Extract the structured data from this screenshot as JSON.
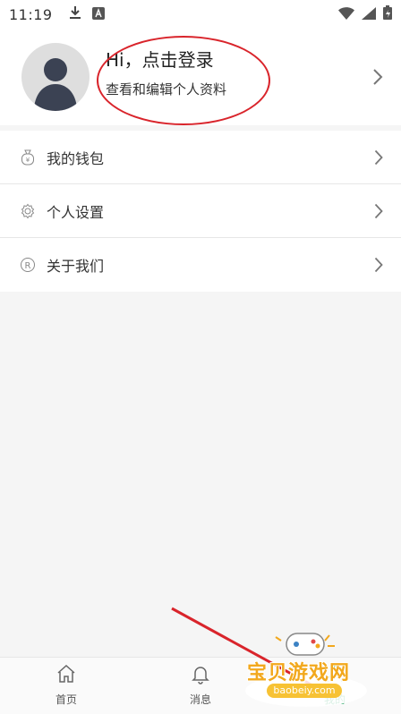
{
  "status_bar": {
    "time": "11:19",
    "left_icons": [
      "download-icon",
      "font-a-icon"
    ],
    "right_icons": [
      "wifi-icon",
      "signal-icon",
      "battery-icon"
    ]
  },
  "profile": {
    "title": "Hi，点击登录",
    "subtitle": "查看和编辑个人资料",
    "annotation_color": "#d9242b"
  },
  "menu": {
    "items": [
      {
        "label": "我的钱包",
        "icon": "wallet-icon"
      },
      {
        "label": "个人设置",
        "icon": "gear-icon"
      },
      {
        "label": "关于我们",
        "icon": "registered-icon"
      }
    ]
  },
  "bottom_nav": {
    "items": [
      {
        "label": "首页",
        "icon": "home-icon"
      },
      {
        "label": "消息",
        "icon": "bell-icon"
      },
      {
        "label": "我的",
        "icon": "user-icon",
        "active": true
      }
    ],
    "active_color": "#1aa05a"
  },
  "watermark": {
    "text": "宝贝游戏网",
    "url": "baobeiy.com"
  }
}
